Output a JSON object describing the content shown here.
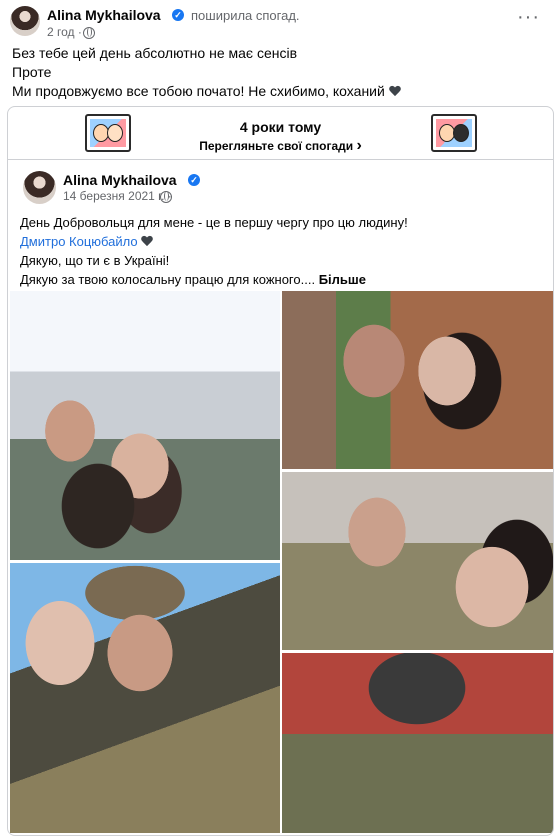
{
  "post": {
    "author": "Alina Mykhailova",
    "action": "поширила спогад.",
    "time": "2 год ·",
    "menu_icon": "more-dots-icon",
    "text_lines": [
      "Без тебе цей день абсолютно не має сенсів",
      "Проте",
      "Ми продовжуємо все тобою почато! Не схибимо, коханий"
    ]
  },
  "memory": {
    "title": "4 роки тому",
    "link": "Перегляньте свої спогади",
    "chevron": "›"
  },
  "shared_post": {
    "author": "Alina Mykhailova",
    "date": "14 березня 2021 г. ·",
    "line1": "День Добровольця для мене - це в першу чергу про цю людину!",
    "mention": "Дмитро Коцюбайло",
    "line3": "Дякую, що ти є в Україні!",
    "line4": "Дякую за твою колосальну працю для кожного....",
    "more": "Більше"
  },
  "colors": {
    "accent": "#1877f2",
    "link": "#216fdb",
    "muted": "#65676b",
    "border": "#ced0d4"
  }
}
